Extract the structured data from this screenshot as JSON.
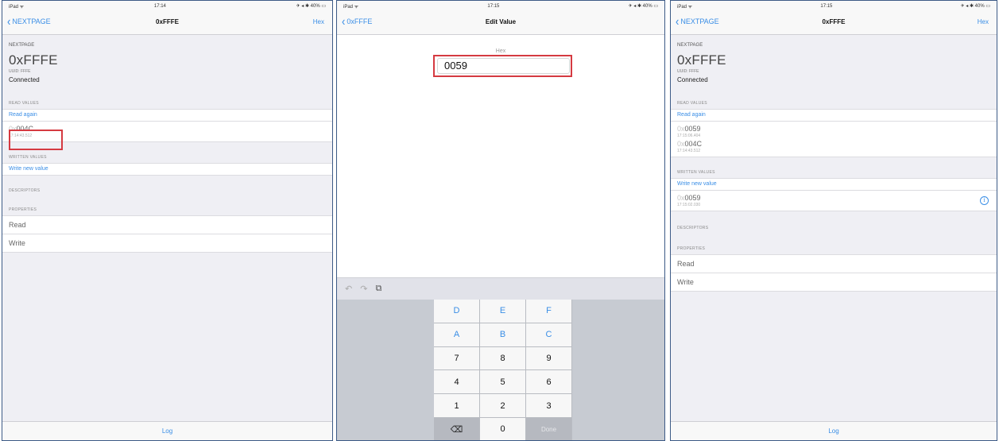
{
  "colors": {
    "accent": "#3a8ee6",
    "highlight": "#d53a41",
    "panel_border": "#3c5a86"
  },
  "p1": {
    "status": {
      "left": "iPad ᯤ",
      "time": "17:14",
      "right": "✈ ◂ ✱ 40% ▭"
    },
    "nav": {
      "back": "NEXTPAGE",
      "title": "0xFFFE",
      "right": "Hex"
    },
    "head": {
      "service": "NEXTPAGE",
      "name": "0xFFFE",
      "uuid": "UUID: FFFE",
      "state": "Connected"
    },
    "read_header": "READ VALUES",
    "read_again": "Read again",
    "read_values": [
      {
        "prefix": "0x",
        "value": "004C",
        "ts": "17:14:43.512"
      }
    ],
    "written_header": "WRITTEN VALUES",
    "write_new": "Write new value",
    "descriptors_header": "DESCRIPTORS",
    "properties_header": "PROPERTIES",
    "properties": [
      "Read",
      "Write"
    ],
    "bottom": "Log"
  },
  "p2": {
    "status": {
      "left": "iPad ᯤ",
      "time": "17:15",
      "right": "✈ ◂ ✱ 40% ▭"
    },
    "nav": {
      "back": "0xFFFE",
      "title": "Edit Value"
    },
    "label": "Hex",
    "input_value": "0059",
    "tools": {
      "undo": "↶",
      "redo": "↷",
      "paste": "⧉"
    },
    "keys": [
      "D",
      "E",
      "F",
      "A",
      "B",
      "C",
      "7",
      "8",
      "9",
      "4",
      "5",
      "6",
      "1",
      "2",
      "3",
      "⌫",
      "0",
      "Done"
    ]
  },
  "p3": {
    "status": {
      "left": "iPad ᯤ",
      "time": "17:15",
      "right": "✈ ◂ ✱ 40% ▭"
    },
    "nav": {
      "back": "NEXTPAGE",
      "title": "0xFFFE",
      "right": "Hex"
    },
    "head": {
      "service": "NEXTPAGE",
      "name": "0xFFFE",
      "uuid": "UUID: FFFE",
      "state": "Connected"
    },
    "read_header": "READ VALUES",
    "read_again": "Read again",
    "read_values": [
      {
        "prefix": "0x",
        "value": "0059",
        "ts": "17:15:06.404"
      },
      {
        "prefix": "0x",
        "value": "004C",
        "ts": "17:14:43.512"
      }
    ],
    "written_header": "WRITTEN VALUES",
    "write_new": "Write new value",
    "written_values": [
      {
        "prefix": "0x",
        "value": "0059",
        "ts": "17:15:02.030",
        "info": "i"
      }
    ],
    "descriptors_header": "DESCRIPTORS",
    "properties_header": "PROPERTIES",
    "properties": [
      "Read",
      "Write"
    ],
    "bottom": "Log"
  }
}
